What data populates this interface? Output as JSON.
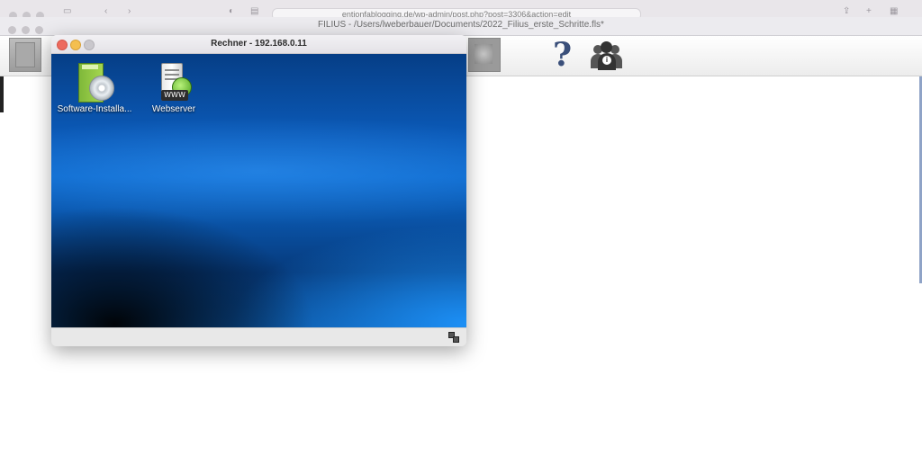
{
  "browser": {
    "url": "entionfablogging.de/wp-admin/post.php?post=3306&action=edit"
  },
  "filius": {
    "title": "FILIUS - /Users/lweberbauer/Documents/2022_Filius_erste_Schritte.fls*",
    "toolbar": {
      "help_glyph": "?",
      "left_icon": "cable-tool-icon",
      "middle_icon": "network-tool-icon",
      "help_icon": "question-mark-icon",
      "info_icon": "people-info-icon"
    }
  },
  "rechner": {
    "title": "Rechner - 192.168.0.11",
    "desktop_icons": [
      {
        "label": "Software-Installa...",
        "icon": "software-installer-icon"
      },
      {
        "label": "Webserver",
        "icon": "webserver-icon",
        "badge": "WWW"
      }
    ]
  },
  "colors": {
    "close": "#ed6a5e",
    "minimize": "#f4bf4f",
    "desktop_blue": "#0c68cc"
  }
}
